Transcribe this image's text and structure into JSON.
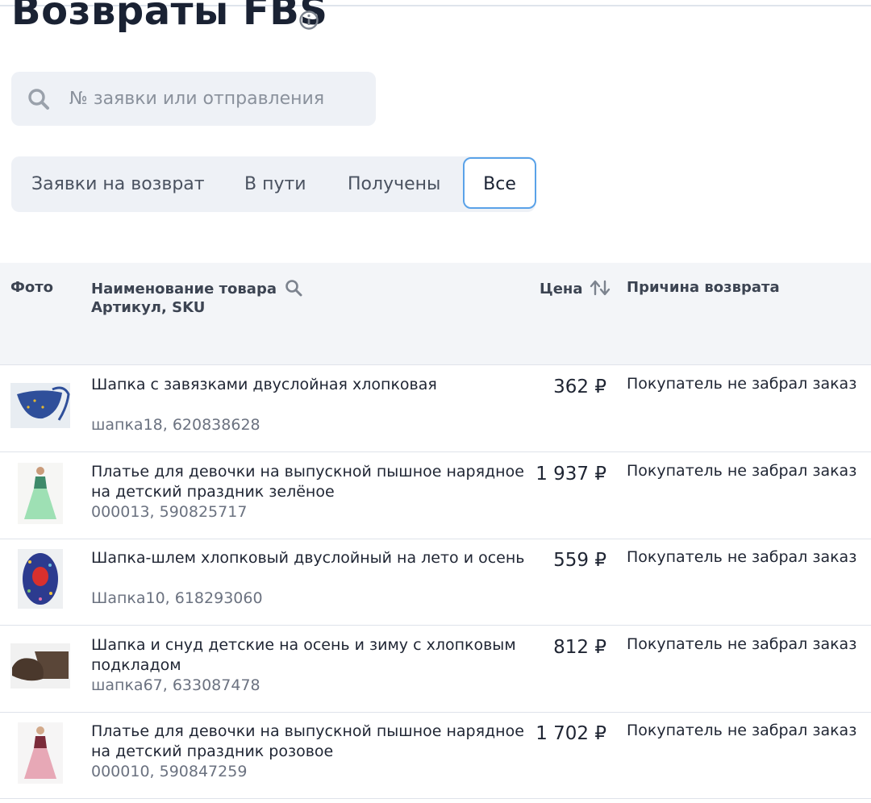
{
  "header": {
    "title": "Возвраты FBS"
  },
  "search": {
    "placeholder": "№ заявки или отправления",
    "value": ""
  },
  "tabs": [
    {
      "label": "Заявки на возврат",
      "active": false
    },
    {
      "label": "В пути",
      "active": false
    },
    {
      "label": "Получены",
      "active": false
    },
    {
      "label": "Все",
      "active": true
    }
  ],
  "table": {
    "headers": {
      "photo": "Фото",
      "name": "Наименование товара",
      "name_sub": "Артикул, SKU",
      "price": "Цена",
      "reason": "Причина возврата"
    },
    "rows": [
      {
        "name": "Шапка с завязками двуслойная хлопковая",
        "article": "шапка18, 620838628",
        "price": "362 ₽",
        "reason": "Покупатель не забрал заказ",
        "thumb_icon": "blue-hat-image"
      },
      {
        "name": "Платье для девочки на выпускной пышное нарядное на детский праздник зелёное",
        "article": "000013, 590825717",
        "price": "1 937 ₽",
        "reason": "Покупатель не забрал заказ",
        "thumb_icon": "green-dress-image"
      },
      {
        "name": "Шапка-шлем хлопковый двуслойный на лето и осень",
        "article": "Шапка10, 618293060",
        "price": "559 ₽",
        "reason": "Покупатель не забрал заказ",
        "thumb_icon": "patterned-helmet-hat-image"
      },
      {
        "name": "Шапка и снуд детские на осень и зиму с хлопковым подкладом",
        "article": "шапка67, 633087478",
        "price": "812 ₽",
        "reason": "Покупатель не забрал заказ",
        "thumb_icon": "brown-hat-snood-image"
      },
      {
        "name": "Платье для девочки на выпускной пышное нарядное на детский праздник розовое",
        "article": "000010, 590847259",
        "price": "1 702 ₽",
        "reason": "Покупатель не забрал заказ",
        "thumb_icon": "pink-dress-image"
      }
    ]
  },
  "colors": {
    "accent_border": "#5aa2e8",
    "surface": "#eef1f6",
    "header_bg": "#f3f5f8"
  }
}
